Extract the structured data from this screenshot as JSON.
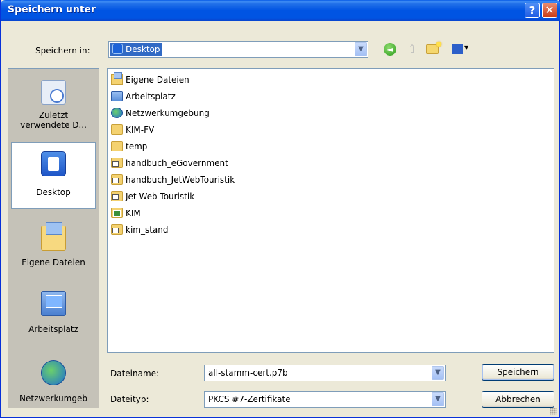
{
  "window": {
    "title": "Speichern unter",
    "help_glyph": "?",
    "close_glyph": "✕"
  },
  "toolbar": {
    "save_in_label": "Speichern in:",
    "save_in_value": "Desktop",
    "dropdown_glyph": "▼",
    "back_icon": "back-arrow-icon",
    "up_icon": "up-folder-icon",
    "new_folder_icon": "new-folder-icon",
    "view_menu_icon": "view-menu-icon"
  },
  "places": [
    {
      "name": "recent",
      "label_line1": "Zuletzt",
      "label_line2": "verwendete D...",
      "icon": "recent-documents-icon",
      "selected": false
    },
    {
      "name": "desktop",
      "label_line1": "Desktop",
      "label_line2": "",
      "icon": "desktop-icon",
      "selected": true
    },
    {
      "name": "my-documents",
      "label_line1": "Eigene Dateien",
      "label_line2": "",
      "icon": "my-documents-icon",
      "selected": false
    },
    {
      "name": "my-computer",
      "label_line1": "Arbeitsplatz",
      "label_line2": "",
      "icon": "my-computer-icon",
      "selected": false
    },
    {
      "name": "network",
      "label_line1": "Netzwerkumgeb",
      "label_line2": "",
      "icon": "network-icon",
      "selected": false
    }
  ],
  "files": [
    {
      "label": "Eigene Dateien",
      "icon": "my-documents-folder-icon"
    },
    {
      "label": "Arbeitsplatz",
      "icon": "my-computer-icon"
    },
    {
      "label": "Netzwerkumgebung",
      "icon": "network-places-icon"
    },
    {
      "label": "KIM-FV",
      "icon": "folder-icon"
    },
    {
      "label": "temp",
      "icon": "folder-icon"
    },
    {
      "label": "handbuch_eGovernment",
      "icon": "folder-shortcut-icon"
    },
    {
      "label": "handbuch_JetWebTouristik",
      "icon": "folder-shortcut-icon"
    },
    {
      "label": "Jet Web Touristik",
      "icon": "folder-shortcut-icon"
    },
    {
      "label": "KIM",
      "icon": "kim-folder-shortcut-icon"
    },
    {
      "label": "kim_stand",
      "icon": "folder-shortcut-icon"
    }
  ],
  "filename": {
    "label": "Dateiname:",
    "value": "all-stamm-cert.p7b"
  },
  "filetype": {
    "label": "Dateityp:",
    "value": "PKCS #7-Zertifikate"
  },
  "buttons": {
    "save": "Speichern",
    "cancel": "Abbrechen"
  }
}
